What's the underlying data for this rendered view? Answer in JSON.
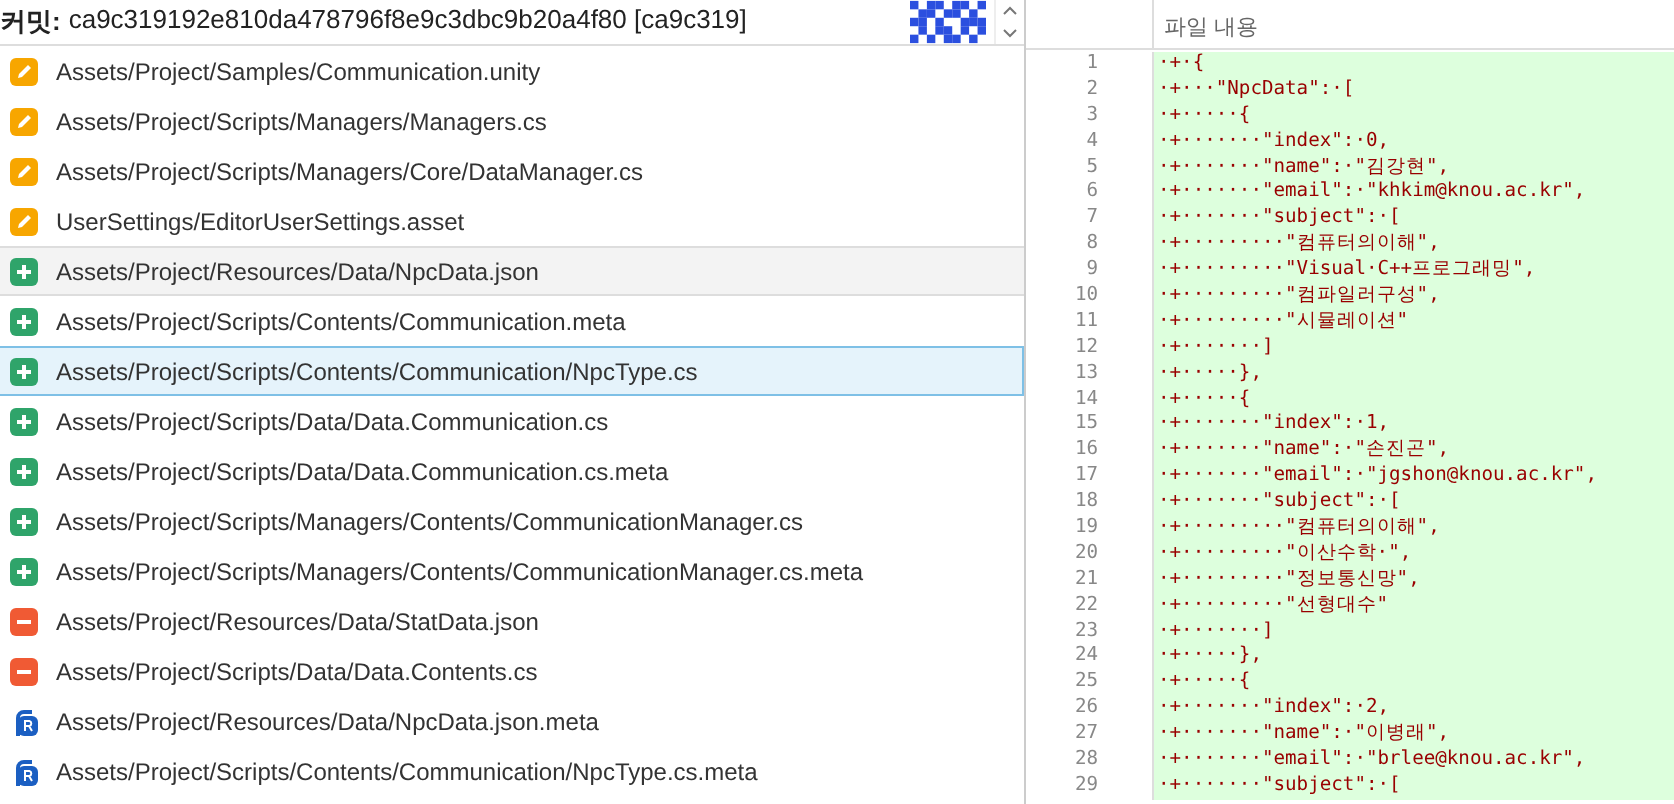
{
  "commit": {
    "label": "커밋:",
    "hash": "ca9c319192e810da478796f8e9c3dbc9b20a4f80 [ca9c319]"
  },
  "files": [
    {
      "path": "Assets/Project/Samples/Communication.unity",
      "kind": "modified",
      "selected": false,
      "hovered": false
    },
    {
      "path": "Assets/Project/Scripts/Managers/Managers.cs",
      "kind": "modified",
      "selected": false,
      "hovered": false
    },
    {
      "path": "Assets/Project/Scripts/Managers/Core/DataManager.cs",
      "kind": "modified",
      "selected": false,
      "hovered": false
    },
    {
      "path": "UserSettings/EditorUserSettings.asset",
      "kind": "modified",
      "selected": false,
      "hovered": false
    },
    {
      "path": "Assets/Project/Resources/Data/NpcData.json",
      "kind": "added",
      "selected": false,
      "hovered": true
    },
    {
      "path": "Assets/Project/Scripts/Contents/Communication.meta",
      "kind": "added",
      "selected": false,
      "hovered": false
    },
    {
      "path": "Assets/Project/Scripts/Contents/Communication/NpcType.cs",
      "kind": "added",
      "selected": true,
      "hovered": false
    },
    {
      "path": "Assets/Project/Scripts/Data/Data.Communication.cs",
      "kind": "added",
      "selected": false,
      "hovered": false
    },
    {
      "path": "Assets/Project/Scripts/Data/Data.Communication.cs.meta",
      "kind": "added",
      "selected": false,
      "hovered": false
    },
    {
      "path": "Assets/Project/Scripts/Managers/Contents/CommunicationManager.cs",
      "kind": "added",
      "selected": false,
      "hovered": false
    },
    {
      "path": "Assets/Project/Scripts/Managers/Contents/CommunicationManager.cs.meta",
      "kind": "added",
      "selected": false,
      "hovered": false
    },
    {
      "path": "Assets/Project/Resources/Data/StatData.json",
      "kind": "removed",
      "selected": false,
      "hovered": false
    },
    {
      "path": "Assets/Project/Scripts/Data/Data.Contents.cs",
      "kind": "removed",
      "selected": false,
      "hovered": false
    },
    {
      "path": "Assets/Project/Resources/Data/NpcData.json.meta",
      "kind": "renamed",
      "selected": false,
      "hovered": false
    },
    {
      "path": "Assets/Project/Scripts/Contents/Communication/NpcType.cs.meta",
      "kind": "renamed",
      "selected": false,
      "hovered": false
    }
  ],
  "viewer": {
    "header": "파일 내용",
    "lines": [
      {
        "number": "1",
        "text": "·+·{",
        "added": true
      },
      {
        "number": "2",
        "text": "·+···\"NpcData\":·[",
        "added": true
      },
      {
        "number": "3",
        "text": "·+·····{",
        "added": true
      },
      {
        "number": "4",
        "text": "·+·······\"index\":·0,",
        "added": true
      },
      {
        "number": "5",
        "text": "·+·······\"name\":·\"김강현\",",
        "added": true
      },
      {
        "number": "6",
        "text": "·+·······\"email\":·\"khkim@knou.ac.kr\",",
        "added": true
      },
      {
        "number": "7",
        "text": "·+·······\"subject\":·[",
        "added": true
      },
      {
        "number": "8",
        "text": "·+·········\"컴퓨터의이해\",",
        "added": true
      },
      {
        "number": "9",
        "text": "·+·········\"Visual·C++프로그래밍\",",
        "added": true
      },
      {
        "number": "10",
        "text": "·+·········\"컴파일러구성\",",
        "added": true
      },
      {
        "number": "11",
        "text": "·+·········\"시뮬레이션\"",
        "added": true
      },
      {
        "number": "12",
        "text": "·+·······]",
        "added": true
      },
      {
        "number": "13",
        "text": "·+·····},",
        "added": true
      },
      {
        "number": "14",
        "text": "·+·····{",
        "added": true
      },
      {
        "number": "15",
        "text": "·+·······\"index\":·1,",
        "added": true
      },
      {
        "number": "16",
        "text": "·+·······\"name\":·\"손진곤\",",
        "added": true
      },
      {
        "number": "17",
        "text": "·+·······\"email\":·\"jgshon@knou.ac.kr\",",
        "added": true
      },
      {
        "number": "18",
        "text": "·+·······\"subject\":·[",
        "added": true
      },
      {
        "number": "19",
        "text": "·+·········\"컴퓨터의이해\",",
        "added": true
      },
      {
        "number": "20",
        "text": "·+·········\"이산수학·\",",
        "added": true
      },
      {
        "number": "21",
        "text": "·+·········\"정보통신망\",",
        "added": true
      },
      {
        "number": "22",
        "text": "·+·········\"선형대수\"",
        "added": true
      },
      {
        "number": "23",
        "text": "·+·······]",
        "added": true
      },
      {
        "number": "24",
        "text": "·+·····},",
        "added": true
      },
      {
        "number": "25",
        "text": "·+·····{",
        "added": true
      },
      {
        "number": "26",
        "text": "·+·······\"index\":·2,",
        "added": true
      },
      {
        "number": "27",
        "text": "·+·······\"name\":·\"이병래\",",
        "added": true
      },
      {
        "number": "28",
        "text": "·+·······\"email\":·\"brlee@knou.ac.kr\",",
        "added": true
      },
      {
        "number": "29",
        "text": "·+·······\"subject\":·[",
        "added": true
      }
    ]
  }
}
